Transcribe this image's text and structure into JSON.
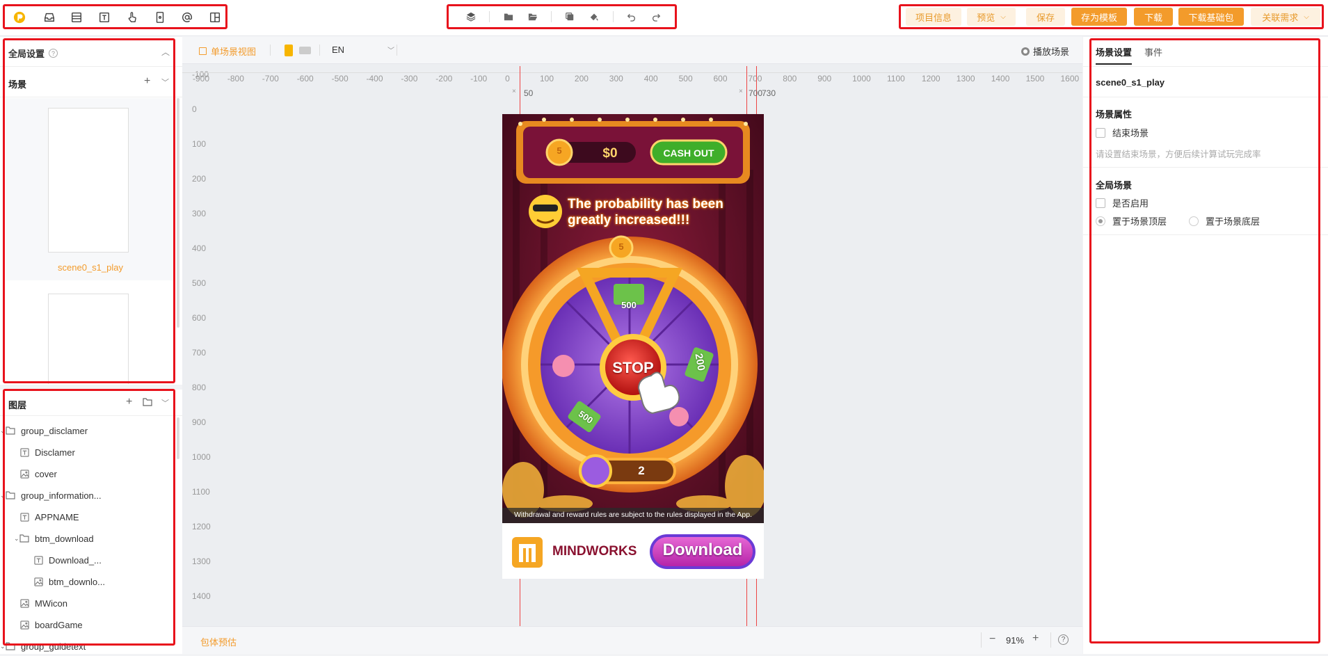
{
  "toolbar_left": [
    "logo",
    "inbox-icon",
    "layout-rows-icon",
    "text-icon",
    "pointer-hand-icon",
    "phone-icon",
    "at-sign-icon",
    "panel-layout-icon"
  ],
  "toolbar_center": [
    "layers-icon",
    "folder-icon",
    "folder-open-icon",
    "copy-icon",
    "paint-brush-icon",
    "undo-icon",
    "redo-icon"
  ],
  "toolbar_right": {
    "project_info": "项目信息",
    "preview": "预览",
    "save": "保存",
    "save_template": "存为模板",
    "download": "下载",
    "download_base": "下载基础包",
    "related_req": "关联需求"
  },
  "left_panel": {
    "global_settings": "全局设置",
    "scenes_title": "场景",
    "scene1_name": "scene0_s1_play",
    "layers_title": "图层",
    "layers": [
      {
        "label": "group_disclamer",
        "type": "folder",
        "indent": 0,
        "caret": true
      },
      {
        "label": "Disclamer",
        "type": "text",
        "indent": 1
      },
      {
        "label": "cover",
        "type": "image",
        "indent": 1
      },
      {
        "label": "group_information...",
        "type": "folder",
        "indent": 0,
        "caret": true
      },
      {
        "label": "APPNAME",
        "type": "text",
        "indent": 1
      },
      {
        "label": "btm_download",
        "type": "folder",
        "indent": 1,
        "caret": true
      },
      {
        "label": "Download_...",
        "type": "text",
        "indent": 2
      },
      {
        "label": "btm_downlo...",
        "type": "image",
        "indent": 2
      },
      {
        "label": "MWicon",
        "type": "image",
        "indent": 1
      },
      {
        "label": "boardGame",
        "type": "image",
        "indent": 1
      },
      {
        "label": "group_guidetext",
        "type": "folder",
        "indent": 0,
        "caret": true
      }
    ]
  },
  "canvas": {
    "single_view": "单场景视图",
    "lang": "EN",
    "play_scene": "播放场景",
    "ruler_h": [
      "-900",
      "-800",
      "-700",
      "-600",
      "-500",
      "-400",
      "-300",
      "-200",
      "-100",
      "0",
      "100",
      "200",
      "300",
      "400",
      "500",
      "600",
      "700",
      "800",
      "900",
      "1000",
      "1100",
      "1200",
      "1300",
      "1400",
      "1500",
      "1600"
    ],
    "ruler_v": [
      "-100",
      "0",
      "100",
      "200",
      "300",
      "400",
      "500",
      "600",
      "700",
      "800",
      "900",
      "1000",
      "1100",
      "1200",
      "1300",
      "1400"
    ],
    "guide_labels": [
      "50",
      "700",
      "730"
    ],
    "footer_estimate": "包体预估",
    "zoom": "91%"
  },
  "game": {
    "cash": "$0",
    "cash_out": "CASH OUT",
    "headline_1": "The probability has been",
    "headline_2": "greatly increased!!!",
    "stop": "STOP",
    "counter": "2",
    "wheel_5": "5",
    "coin_5": "5",
    "prize_500a": "500",
    "prize_200": "200",
    "prize_500b": "500",
    "disclaimer": "Withdrawal and reward rules are subject to the rules displayed in the App.",
    "brand": "MINDWORKS",
    "download": "Download"
  },
  "right_panel": {
    "tab_scene": "场景设置",
    "tab_event": "事件",
    "scene_name": "scene0_s1_play",
    "scene_props": "场景属性",
    "end_scene": "结束场景",
    "end_scene_hint": "请设置结束场景，方便后续计算试玩完成率",
    "global_scene": "全局场景",
    "enable": "是否启用",
    "top_layer": "置于场景顶层",
    "bottom_layer": "置于场景底层"
  },
  "colors": {
    "accent": "#f39b2b",
    "highlight": "#e8121c",
    "purple": "#8a4fd6"
  }
}
